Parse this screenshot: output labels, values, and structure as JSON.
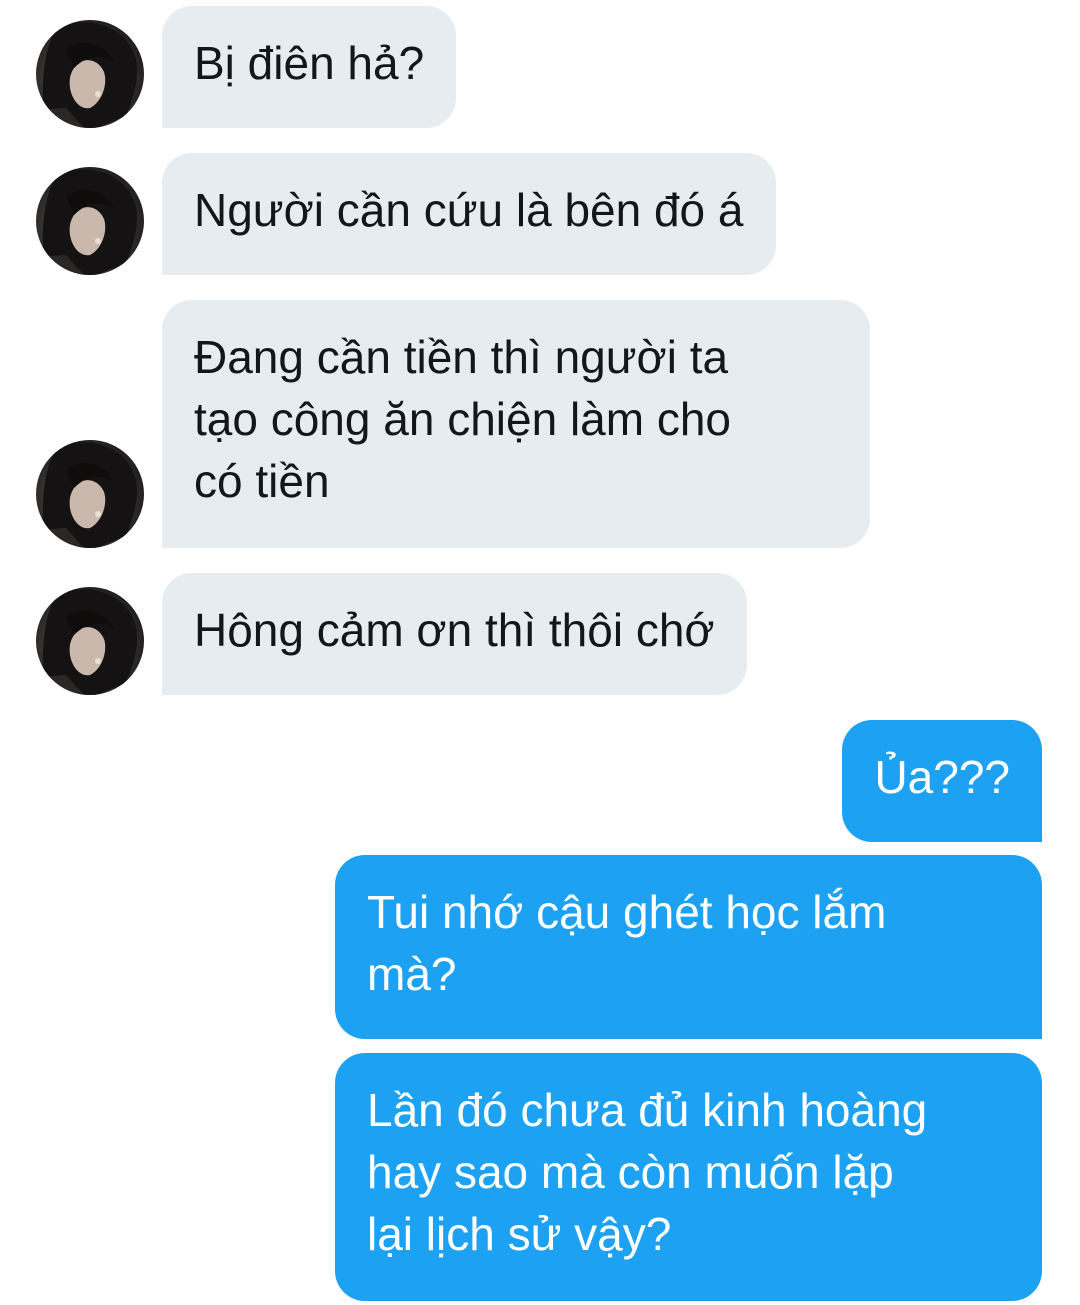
{
  "conversation": {
    "contact_avatar_icon": "profile-photo",
    "colors": {
      "received_bubble": "#e6ecf0",
      "received_text": "#14171a",
      "sent_bubble": "#1da1f2",
      "sent_text": "#ffffff"
    },
    "messages": [
      {
        "direction": "received",
        "text": "Bị điên hả?"
      },
      {
        "direction": "received",
        "text": "Người cần cứu là bên đó á"
      },
      {
        "direction": "received",
        "text": "Đang cần tiền thì người ta\ntạo công ăn chiện làm cho\ncó tiền"
      },
      {
        "direction": "received",
        "text": "Hông cảm ơn thì thôi chớ"
      },
      {
        "direction": "sent",
        "text": "Ủa???"
      },
      {
        "direction": "sent",
        "text": "Tui nhớ cậu ghét học lắm\nmà?"
      },
      {
        "direction": "sent",
        "text": "Lần đó chưa đủ kinh hoàng\nhay sao mà còn muốn lặp\nlại lịch sử vậy?"
      }
    ]
  }
}
